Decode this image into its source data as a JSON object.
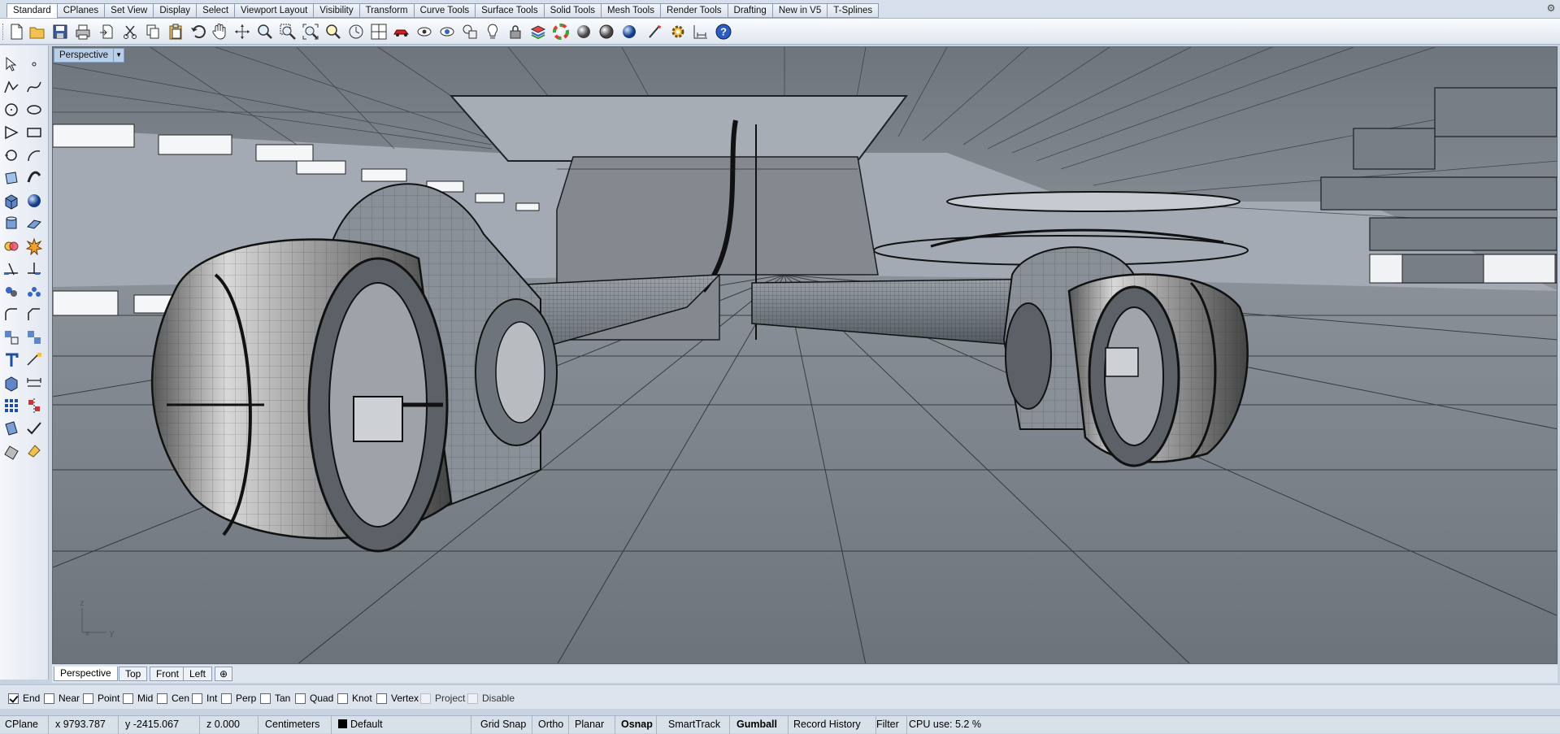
{
  "tabs": [
    "Standard",
    "CPlanes",
    "Set View",
    "Display",
    "Select",
    "Viewport Layout",
    "Visibility",
    "Transform",
    "Curve Tools",
    "Surface Tools",
    "Solid Tools",
    "Mesh Tools",
    "Render Tools",
    "Drafting",
    "New in V5",
    "T-Splines"
  ],
  "viewport": {
    "title": "Perspective",
    "tabs": [
      "Perspective",
      "Top",
      "Front",
      "Left"
    ],
    "axis_labels": {
      "z": "z",
      "x": "x",
      "y": "y"
    }
  },
  "osnap": [
    {
      "label": "End",
      "checked": true,
      "disabled": false
    },
    {
      "label": "Near",
      "checked": false,
      "disabled": false
    },
    {
      "label": "Point",
      "checked": false,
      "disabled": false
    },
    {
      "label": "Mid",
      "checked": false,
      "disabled": false
    },
    {
      "label": "Cen",
      "checked": false,
      "disabled": false
    },
    {
      "label": "Int",
      "checked": false,
      "disabled": false
    },
    {
      "label": "Perp",
      "checked": false,
      "disabled": false
    },
    {
      "label": "Tan",
      "checked": false,
      "disabled": false
    },
    {
      "label": "Quad",
      "checked": false,
      "disabled": false
    },
    {
      "label": "Knot",
      "checked": false,
      "disabled": false
    },
    {
      "label": "Vertex",
      "checked": false,
      "disabled": false
    },
    {
      "label": "Project",
      "checked": false,
      "disabled": true
    },
    {
      "label": "Disable",
      "checked": false,
      "disabled": true
    }
  ],
  "status": {
    "cplane": "CPlane",
    "x": "x 9793.787",
    "y": "y -2415.067",
    "z": "z 0.000",
    "units": "Centimeters",
    "layer": "Default",
    "grid_snap": "Grid Snap",
    "ortho": "Ortho",
    "planar": "Planar",
    "osnap": "Osnap",
    "smarttrack": "SmartTrack",
    "gumball": "Gumball",
    "record_history": "Record History",
    "filter": "Filter",
    "cpu": "CPU use: 5.2 %"
  }
}
